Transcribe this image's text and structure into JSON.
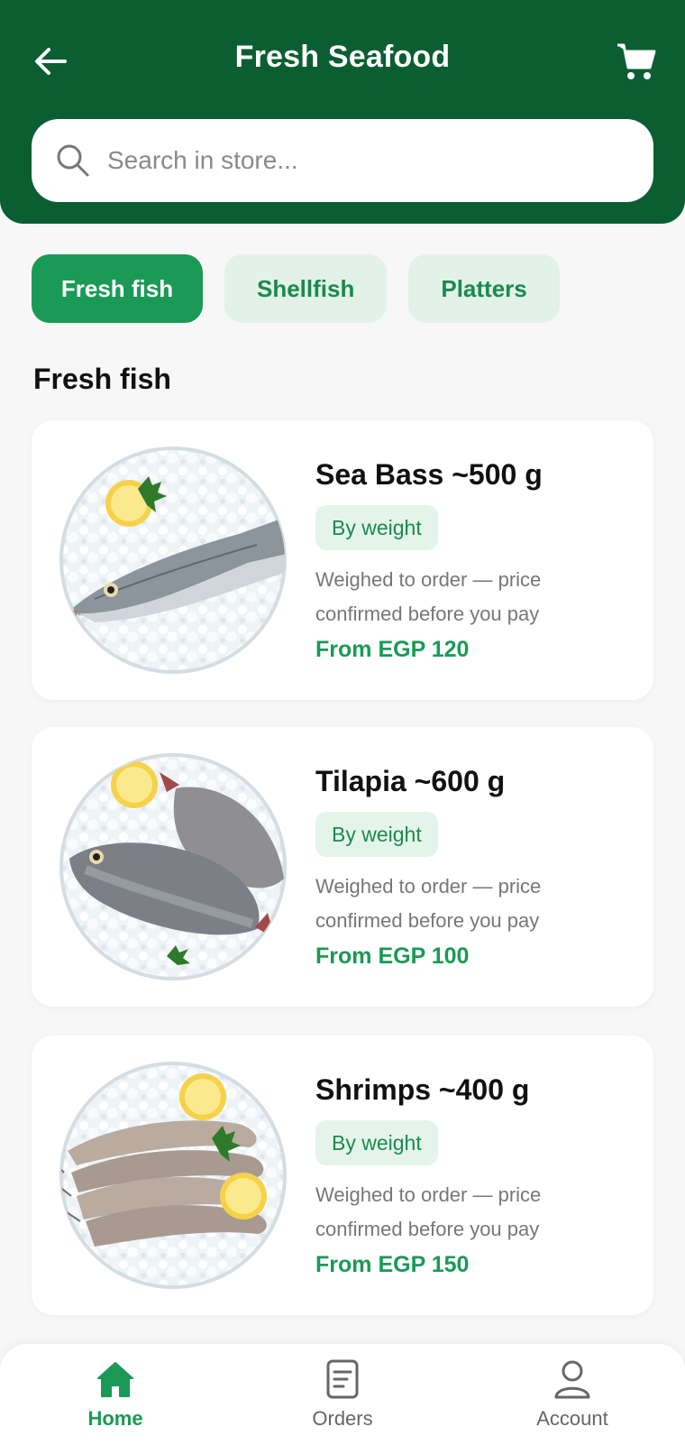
{
  "header": {
    "title": "Fresh Seafood",
    "back_icon": "arrow-left-icon",
    "cart_icon": "cart-icon"
  },
  "search": {
    "placeholder": "Search in store..."
  },
  "categories": [
    {
      "label": "Fresh fish",
      "active": true
    },
    {
      "label": "Shellfish",
      "active": false
    },
    {
      "label": "Platters",
      "active": false
    }
  ],
  "section": {
    "title": "Fresh fish"
  },
  "products": [
    {
      "name": "Sea Bass ~500 g",
      "badge": "By weight",
      "description": "Weighed to order — price confirmed before you pay",
      "price": "From EGP 120"
    },
    {
      "name": "Tilapia ~600 g",
      "badge": "By weight",
      "description": "Weighed to order — price confirmed before you pay",
      "price": "From EGP 100"
    },
    {
      "name": "Shrimps ~400 g",
      "badge": "By weight",
      "description": "Weighed to order — price confirmed before you pay",
      "price": "From EGP 150"
    }
  ],
  "bottom_nav": [
    {
      "label": "Home",
      "icon": "home-icon",
      "active": true
    },
    {
      "label": "Orders",
      "icon": "orders-icon",
      "active": false
    },
    {
      "label": "Account",
      "icon": "account-icon",
      "active": false
    }
  ],
  "colors": {
    "header_green": "#0b5e31",
    "accent_green": "#1a9a56",
    "chip_inactive_bg": "#e3f2e8",
    "background": "#f6f7f6"
  }
}
